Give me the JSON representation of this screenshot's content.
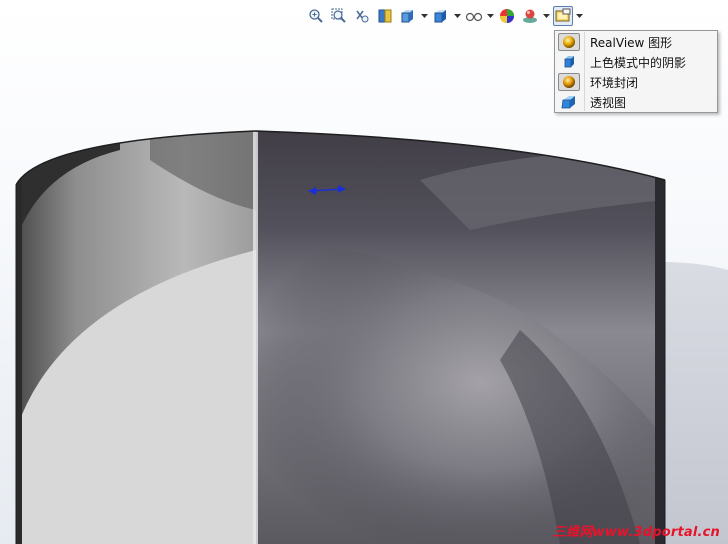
{
  "toolbar": {
    "buttons": [
      {
        "name": "zoom-to-fit-icon",
        "arrow": false
      },
      {
        "name": "zoom-to-area-icon",
        "arrow": false
      },
      {
        "name": "previous-view-icon",
        "arrow": false
      },
      {
        "name": "section-view-icon",
        "arrow": false
      },
      {
        "name": "view-orientation-icon",
        "arrow": true
      },
      {
        "name": "display-style-icon",
        "arrow": true
      },
      {
        "name": "hide-show-items-icon",
        "arrow": true
      },
      {
        "name": "edit-appearance-icon",
        "arrow": false
      },
      {
        "name": "apply-scene-icon",
        "arrow": true
      },
      {
        "name": "view-settings-icon",
        "arrow": true,
        "active": true
      }
    ]
  },
  "view_settings_menu": {
    "items": [
      {
        "label": "RealView 图形",
        "icon": "realview-sphere-icon",
        "checked": true
      },
      {
        "label": "上色模式中的阴影",
        "icon": "shadows-shaded-cube-icon",
        "checked": false
      },
      {
        "label": "环境封闭",
        "icon": "ambient-occlusion-sphere-icon",
        "checked": true
      },
      {
        "label": "透视图",
        "icon": "perspective-cube-icon",
        "checked": false
      }
    ]
  },
  "watermark": {
    "text": "三维网www.3dportal.cn",
    "color": "#e8132b"
  },
  "colors": {
    "accent": "#5d7fae",
    "menu_bg": "#f5f5f5"
  }
}
